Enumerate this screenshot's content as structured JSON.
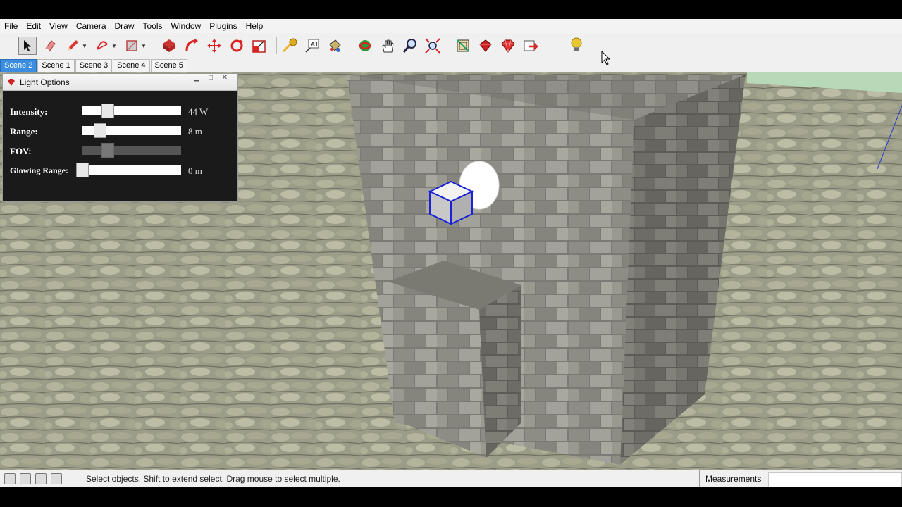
{
  "menu": [
    "File",
    "Edit",
    "View",
    "Camera",
    "Draw",
    "Tools",
    "Window",
    "Plugins",
    "Help"
  ],
  "toolbar": {
    "tools": [
      "select-icon",
      "eraser-icon",
      "pencil-icon",
      "arc-icon",
      "rectangle-icon",
      "push-pull-icon",
      "follow-me-icon",
      "move-icon",
      "rotate-icon",
      "scale-icon",
      "tape-measure-icon",
      "text-icon",
      "paint-bucket-icon",
      "orbit-icon",
      "pan-icon",
      "zoom-icon",
      "zoom-extents-icon",
      "component-icon",
      "ruby-plugin-icon",
      "ruby-gem-icon",
      "export-icon",
      "light-bulb-icon"
    ]
  },
  "scenes": [
    {
      "label": "Scene 2",
      "active": true
    },
    {
      "label": "Scene 1",
      "active": false
    },
    {
      "label": "Scene 3",
      "active": false
    },
    {
      "label": "Scene 4",
      "active": false
    },
    {
      "label": "Scene 5",
      "active": false
    }
  ],
  "light_options": {
    "title": "Light Options",
    "rows": [
      {
        "label": "Intensity:",
        "value": "44 W",
        "level": 0.22,
        "enabled": true
      },
      {
        "label": "Range:",
        "value": "8 m",
        "level": 0.13,
        "enabled": true
      },
      {
        "label": "FOV:",
        "value": "",
        "level": 0.22,
        "enabled": false
      },
      {
        "label": "Glowing Range:",
        "value": "0 m",
        "level": 0.0,
        "enabled": true
      }
    ]
  },
  "status": {
    "hint": "Select objects. Shift to extend select. Drag mouse to select multiple.",
    "measurements_label": "Measurements",
    "measurements_value": ""
  },
  "colors": {
    "accent": "#3a8de0",
    "panel_bg": "#1a1a1a",
    "stone": "#8a8a80",
    "ground": "#9a9a84"
  }
}
